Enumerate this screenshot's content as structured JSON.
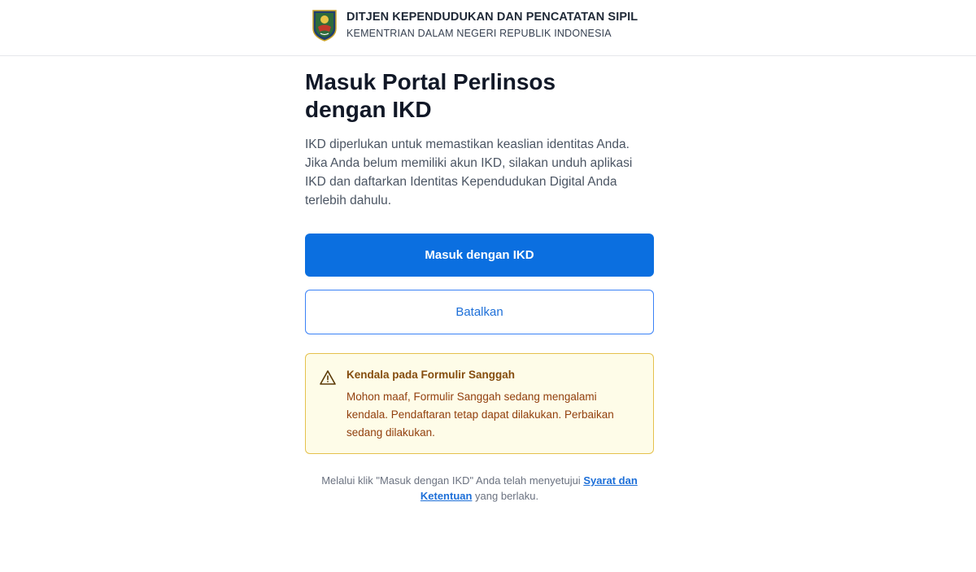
{
  "header": {
    "title": "DITJEN KEPENDUDUKAN DAN PENCATATAN SIPIL",
    "subtitle": "KEMENTRIAN DALAM NEGERI REPUBLIK INDONESIA",
    "logo_icon": "dukcapil-emblem-icon"
  },
  "main": {
    "title": "Masuk Portal Perlinsos dengan IKD",
    "description": "IKD diperlukan untuk memastikan keaslian identitas Anda. Jika Anda belum memiliki akun IKD, silakan unduh aplikasi IKD dan daftarkan Identitas Kependudukan Digital Anda terlebih dahulu.",
    "primary_button": "Masuk dengan IKD",
    "secondary_button": "Batalkan"
  },
  "alert": {
    "icon": "warning-icon",
    "title": "Kendala pada Formulir Sanggah",
    "body": "Mohon maaf, Formulir Sanggah sedang mengalami kendala. Pendaftaran tetap dapat dilakukan. Perbaikan sedang dilakukan."
  },
  "footnote": {
    "prefix": "Melalui klik \"Masuk dengan IKD\" Anda telah menyetujui ",
    "link": "Syarat dan Ketentuan",
    "suffix": " yang berlaku."
  },
  "colors": {
    "primary": "#0b6fe0",
    "alert_bg": "#fefce8",
    "alert_border": "#e5c14c",
    "alert_text": "#92400e"
  }
}
